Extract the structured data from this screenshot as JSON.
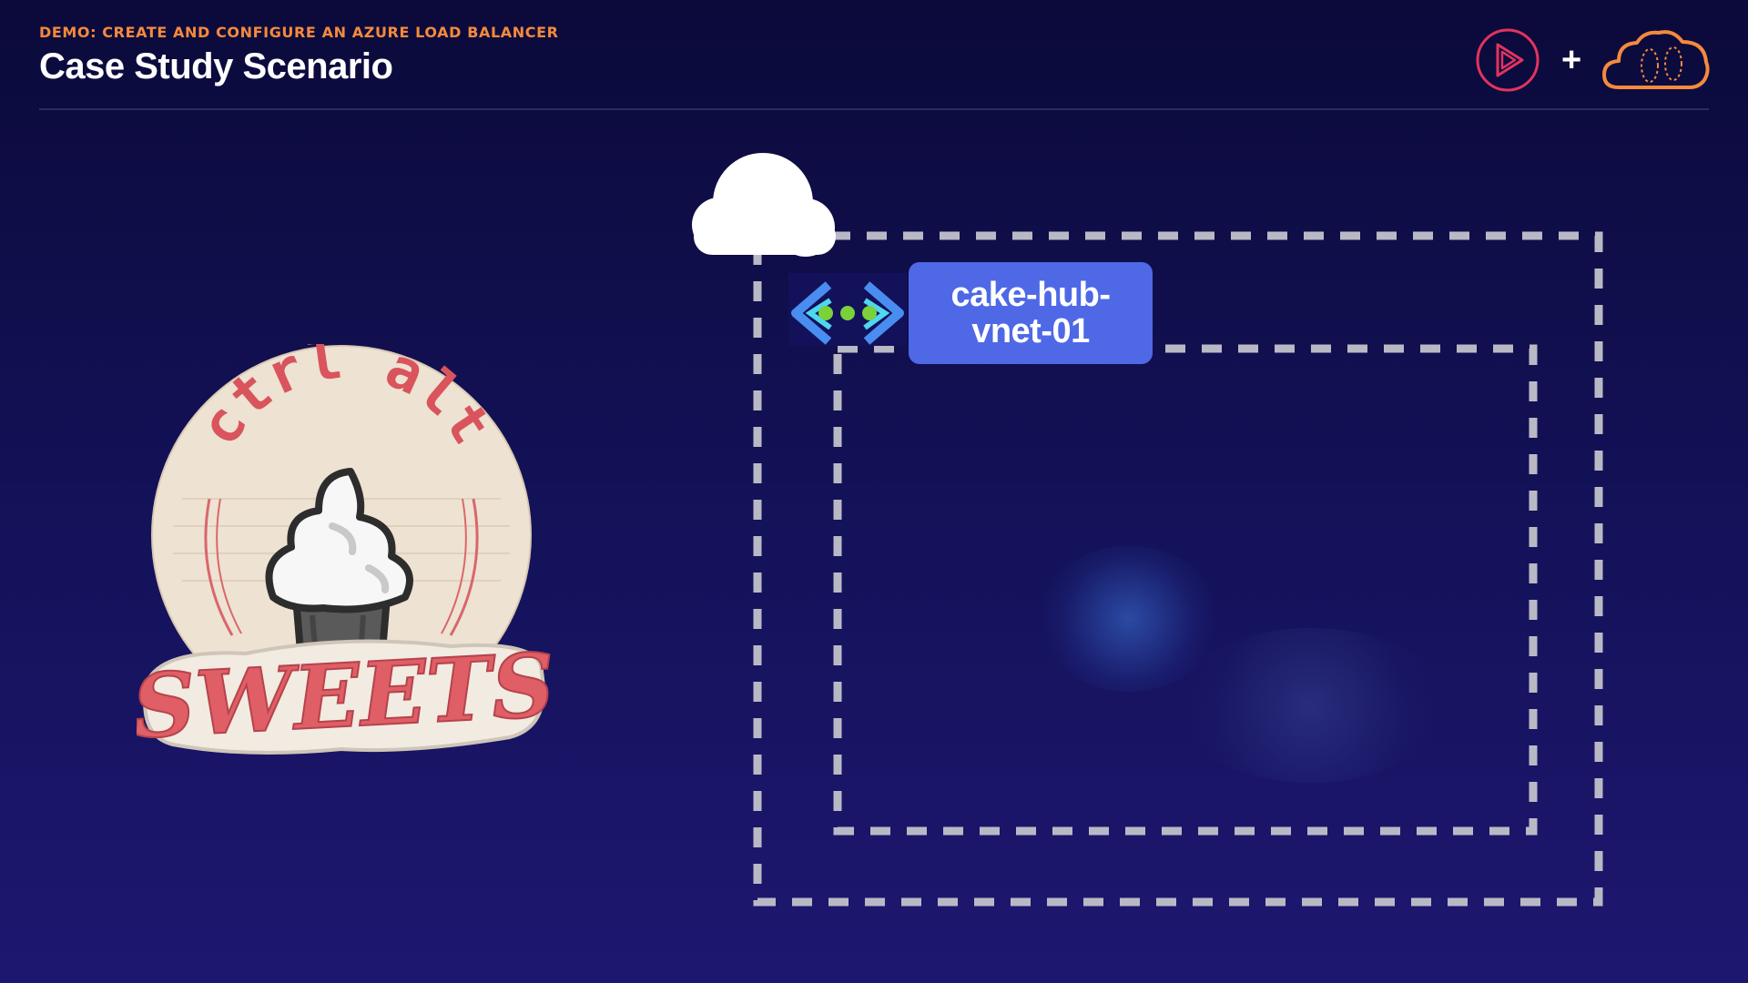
{
  "header": {
    "kicker": "DEMO: CREATE AND CONFIGURE AN AZURE LOAD BALANCER",
    "title": "Case Study Scenario"
  },
  "brand": {
    "plus": "+",
    "icons": [
      "pluralsight-play-icon",
      "cloud-icon"
    ],
    "colors": {
      "pluralsight": "#e2335f",
      "cloud": "#f58a3c"
    }
  },
  "logo": {
    "top_text": "ctrl alt",
    "bottom_text": "SWEETS",
    "icon": "cupcake-icon"
  },
  "diagram": {
    "internet_icon": "cloud-icon",
    "vnet_icon": "virtual-network-icon",
    "vnet_label": "cake-hub-\nvnet-01",
    "colors": {
      "label_bg": "#4f68e6",
      "dash": "#b9b9c6",
      "dots": "#7ad13a"
    }
  }
}
